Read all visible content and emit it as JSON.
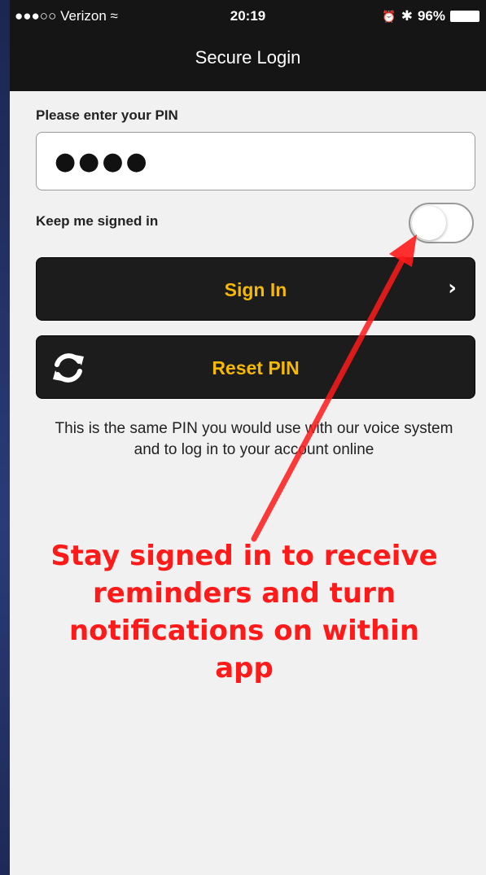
{
  "status_bar": {
    "signal": "●●●○○",
    "carrier": "Verizon",
    "wifi_glyph": "≈",
    "time": "20:19",
    "alarm_glyph": "⏰",
    "bluetooth_glyph": "✱",
    "battery": "96%"
  },
  "nav": {
    "title": "Secure Login"
  },
  "form": {
    "pin_label": "Please enter your PIN",
    "pin_value": "●●●●",
    "keep_signed_in_label": "Keep me signed in",
    "keep_signed_in": false
  },
  "buttons": {
    "sign_in": "Sign In",
    "sign_in_chevron": "›",
    "reset_pin": "Reset PIN"
  },
  "helper_text": "This is the same PIN you would use with our voice system and to log in to your account online",
  "annotation": {
    "text": "Stay signed in to receive reminders and turn notifications on within app"
  },
  "colors": {
    "accent_yellow": "#f6b800",
    "annotation_red": "#ff1a1a",
    "nav_bg": "#151515",
    "page_bg": "#f1f1f1"
  },
  "icons": {
    "reset": "refresh-icon",
    "chevron": "chevron-right-icon",
    "wifi": "wifi-icon",
    "alarm": "alarm-icon",
    "bluetooth": "bluetooth-icon",
    "battery": "battery-icon"
  }
}
